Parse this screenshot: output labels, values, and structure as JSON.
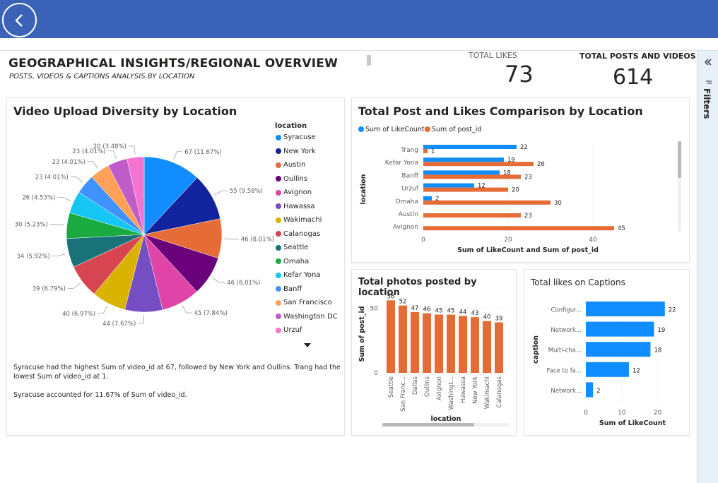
{
  "header": {
    "title": "GEOGRAPHICAL INSIGHTS/REGIONAL OVERVIEW",
    "subtitle": "POSTS, VIDEOS & CAPTIONS ANALYSIS BY LOCATION"
  },
  "kpis": {
    "likes_label": "TOTAL LIKES",
    "likes_value": "73",
    "posts_label": "TOTAL POSTS AND VIDEOS",
    "posts_value": "614"
  },
  "filters_label": "Filters",
  "narrative": {
    "line1": "Syracuse had the highest Sum of video_id at 67, followed by New York and Oullins. Trang had the",
    "line2": "lowest Sum of video_id at 1.",
    "line3": "Syracuse accounted for 11.67% of Sum of video_id."
  },
  "chart_data": [
    {
      "type": "pie",
      "title": "Video Upload Diversity by Location",
      "legend_title": "location",
      "labels": [
        "Syracuse",
        "New York",
        "Austin",
        "Oullins",
        "Avignon",
        "Hawassa",
        "Wakimachi",
        "Calanogas",
        "Seattle",
        "Omaha",
        "Kefar Yona",
        "Banff",
        "San Francisco",
        "Washington DC",
        "Urzuf"
      ],
      "values": [
        67,
        55,
        46,
        46,
        45,
        44,
        40,
        39,
        34,
        30,
        26,
        23,
        23,
        23,
        20
      ],
      "data_labels": [
        "67 (11.67%)",
        "55 (9.58%)",
        "46 (8.01%)",
        "46 (8.01%)",
        "45 (7.84%)",
        "44 (7.67%)",
        "40 (6.97%)",
        "39 (6.79%)",
        "34 (5.92%)",
        "30 (5.23%)",
        "26 (4.53%)",
        "23 (4.01%)",
        "23 (4.01%)",
        "23 (4.01%)",
        "20 (3.48%)"
      ],
      "colors": [
        "#118DFF",
        "#12239E",
        "#E66C37",
        "#6B007B",
        "#E044A7",
        "#744EC2",
        "#D9B300",
        "#D64550",
        "#197278",
        "#1AAB40",
        "#15C6F4",
        "#4092FF",
        "#FFA058",
        "#BE5DC9",
        "#F472D0",
        "#B5A1FF"
      ]
    },
    {
      "type": "bar",
      "orientation": "horizontal",
      "title": "Total Post and Likes Comparison by Location",
      "categories": [
        "Trang",
        "Kefar Yona",
        "Banff",
        "Urzuf",
        "Omaha",
        "Austin",
        "Avignon"
      ],
      "series": [
        {
          "name": "Sum of LikeCount",
          "values": [
            22,
            19,
            18,
            12,
            2,
            null,
            null
          ],
          "color": "#118DFF"
        },
        {
          "name": "Sum of post_id",
          "values": [
            1,
            26,
            23,
            20,
            30,
            23,
            45
          ],
          "color": "#E66C37"
        }
      ],
      "xlabel": "Sum of LikeCount and Sum of post_id",
      "ylabel": "location",
      "xticks": [
        "0",
        "20",
        "40"
      ],
      "xlim": [
        0,
        50
      ]
    },
    {
      "type": "bar",
      "title": "Total photos posted by location",
      "categories": [
        "Seattle",
        "San Franc...",
        "Dallas",
        "Oullins",
        "Avignon",
        "Washingt...",
        "Hawassa",
        "New York",
        "Wakimachi",
        "Calanogas"
      ],
      "values": [
        56,
        52,
        47,
        46,
        45,
        45,
        44,
        43,
        40,
        39
      ],
      "xlabel": "location",
      "ylabel": "Sum of post_id",
      "yticks": [
        "0",
        "50"
      ],
      "ylim": [
        0,
        60
      ],
      "color": "#E66C37"
    },
    {
      "type": "bar",
      "orientation": "horizontal",
      "title": "Total likes on Captions",
      "categories": [
        "Configur...",
        "Network...",
        "Multi-cha...",
        "Face to fa...",
        "Network..."
      ],
      "values": [
        22,
        19,
        18,
        12,
        2
      ],
      "xlabel": "Sum of LikeCount",
      "ylabel": "caption",
      "xticks": [
        "0",
        "10",
        "20"
      ],
      "xlim": [
        0,
        25
      ],
      "color": "#118DFF"
    }
  ]
}
